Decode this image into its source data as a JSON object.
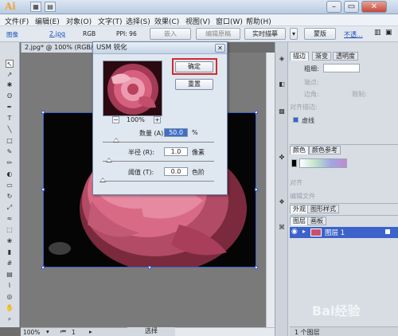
{
  "app": {
    "logo": "Ai"
  },
  "window_controls": {
    "minimize": "–",
    "restore": "▭",
    "close": "✕"
  },
  "menu": [
    "文件(F)",
    "编辑(E)",
    "对象(O)",
    "文字(T)",
    "选择(S)",
    "效果(C)",
    "视图(V)",
    "窗口(W)",
    "帮助(H)"
  ],
  "control_bar": {
    "image_label": "图像",
    "file_link": "2.jpg",
    "color_mode": "RGB",
    "ppi": "PPI: 96",
    "embed_btn": "嵌入",
    "edit_original_btn": "编辑原稿",
    "live_trace_btn": "实时描摹",
    "mask_btn": "蒙版",
    "opacity_link": "不透..."
  },
  "document_tab": "2.jpg* @ 100% (RGB/...",
  "dialog": {
    "title": "USM 锐化",
    "close": "✕",
    "ok_btn": "确定",
    "reset_btn": "重置",
    "zoom_out": "−",
    "zoom_in": "+",
    "zoom_level": "100%",
    "amount_label": "数量 (A):",
    "amount_value": "50.0",
    "amount_unit": "%",
    "radius_label": "半径 (R):",
    "radius_value": "1.0",
    "radius_unit": "像素",
    "threshold_label": "阈值 (T):",
    "threshold_value": "0.0",
    "threshold_unit": "色阶"
  },
  "stroke_panel": {
    "tabs": [
      "描边",
      "渐变",
      "透明度"
    ],
    "weight_label": "粗细:",
    "cap_label": "端点:",
    "corner_label": "边角:",
    "limit_label": "限制:",
    "align_label": "对齐描边:",
    "dashed_label": "虚线"
  },
  "color_panel": {
    "tabs": [
      "颜色",
      "颜色参考"
    ],
    "arrange_label": "对齐",
    "edit_label": "编辑文件"
  },
  "appearance_tabs": [
    "外观",
    "图形样式"
  ],
  "layers_panel": {
    "tabs": [
      "图层",
      "画板"
    ],
    "layer_name": "图层 1",
    "layer_count": "1 个图层"
  },
  "status": {
    "zoom": "100%",
    "page": "1",
    "selection": "选择"
  },
  "watermark": "Bai经验",
  "colors": {
    "accent": "#3b63c9",
    "highlight": "#d62a2a",
    "flower": "#d96a86"
  }
}
